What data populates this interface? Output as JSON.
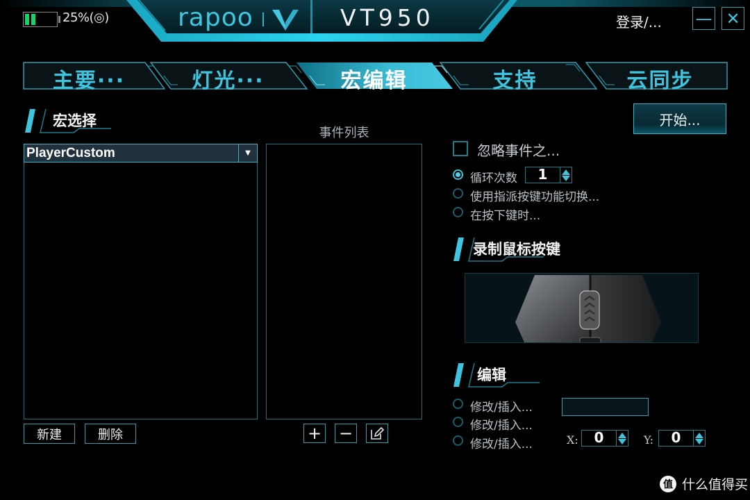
{
  "header": {
    "battery_percent": 25,
    "battery_label": "25%",
    "wireless_icon": "wireless-signal-icon",
    "brand": "rapoo",
    "brand_mark_icon": "v-logo-icon",
    "model": "VT950",
    "login_label": "登录/...",
    "minimize_icon": "minimize-icon",
    "close_icon": "close-icon",
    "minimize_glyph": "—",
    "close_glyph": "✕"
  },
  "tabs": [
    {
      "label": "主要···",
      "active": false
    },
    {
      "label": "灯光···",
      "active": false
    },
    {
      "label": "宏编辑",
      "active": true
    },
    {
      "label": "支持",
      "active": false
    },
    {
      "label": "云同步",
      "active": false
    }
  ],
  "macro_select": {
    "title": "宏选择",
    "selected": "PlayerCustom",
    "items": [],
    "new_label": "新建",
    "delete_label": "删除"
  },
  "event_list": {
    "title": "事件列表",
    "items": [],
    "add_glyph": "+",
    "remove_glyph": "−",
    "edit_icon": "edit-pencil-icon"
  },
  "options": {
    "start_label": "开始...",
    "ignore_events_label": "忽略事件之...",
    "ignore_events_checked": false,
    "repeat_modes": [
      {
        "label": "循环次数",
        "selected": true
      },
      {
        "label": "使用指派按键功能切换...",
        "selected": false
      },
      {
        "label": "在按下键时...",
        "selected": false
      }
    ],
    "loop_count": "1"
  },
  "record_mouse": {
    "title": "录制鼠标按键"
  },
  "edit": {
    "title": "编辑",
    "modes": [
      {
        "label": "修改/插入...",
        "selected": false
      },
      {
        "label": "修改/插入...",
        "selected": false
      },
      {
        "label": "修改/插入...",
        "selected": false
      }
    ],
    "field_value": "",
    "x_label": "X:",
    "y_label": "Y:",
    "x_value": "0",
    "y_value": "0"
  },
  "watermark": {
    "logo": "值",
    "text": "什么值得买"
  },
  "colors": {
    "accent": "#3ec4de",
    "accent_dark": "#1c6f80",
    "battery": "#19d36a",
    "background": "#000000"
  }
}
